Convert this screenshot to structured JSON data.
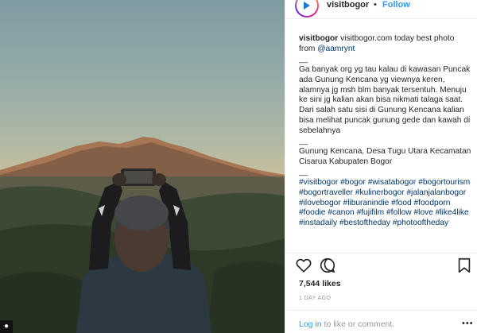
{
  "post": {
    "username": "visitbogor",
    "follow_dot": "•",
    "follow_label": "Follow"
  },
  "caption": {
    "author": "visitbogor",
    "headline": "visitbogor.com today best photo from",
    "mention": "@aamrynt",
    "separator": "__",
    "body": "Ga banyak org yg tau kalau di kawasan Puncak ada Gunung Kencana yg viewnya keren, alamnya jg msh blm banyak tersentuh. Menuju ke sini jg kalian akan bisa nikmati talaga saat. Dari salah satu sisi di Gunung Kencana kalian bisa melihat puncak gunung gede dan kawah di sebelahnya",
    "location": "Gunung Kencana, Desa Tugu Utara Kecamatan Cisarua Kabupaten Bogor",
    "hashtags": [
      "#visitbogor",
      "#bogor",
      "#wisatabogor",
      "#bogortourism",
      "#bogortraveller",
      "#kulinerbogor",
      "#jalanjalanbogor",
      "#ilovebogor",
      "#liburanindie",
      "#food",
      "#foodporn",
      "#foodie",
      "#canon",
      "#fujifilm",
      "#follow",
      "#love",
      "#like4like",
      "#instadaily",
      "#bestoftheday",
      "#photooftheday"
    ]
  },
  "actions": {
    "like_icon": "heart-outline-icon",
    "comment_icon": "comment-bubble-icon",
    "save_icon": "bookmark-icon"
  },
  "stats": {
    "likes": "7,544 likes",
    "timestamp": "1 DAY AGO"
  },
  "footer": {
    "login_link": "Log in",
    "login_suffix": " to like or comment.",
    "more_label": "•••"
  },
  "colors": {
    "link_blue": "#3897f0",
    "hashtag_blue": "#003569",
    "text": "#262626",
    "muted": "#999999"
  }
}
